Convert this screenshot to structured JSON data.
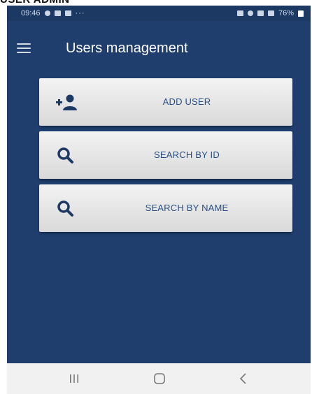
{
  "header_label": "USER ADMIN",
  "status_bar": {
    "time": "09:46",
    "dots": "···",
    "battery": "76%"
  },
  "app_bar": {
    "title": "Users management",
    "menu_icon": "hamburger-menu-icon"
  },
  "menu": [
    {
      "label": "ADD USER",
      "icon": "add-user-icon"
    },
    {
      "label": "SEARCH BY ID",
      "icon": "search-icon"
    },
    {
      "label": "SEARCH BY NAME",
      "icon": "search-icon"
    }
  ],
  "nav_bar": {
    "recents_icon": "recents-icon",
    "home_icon": "home-icon",
    "back_icon": "back-icon"
  },
  "colors": {
    "background": "#1f3e6e",
    "button": "#e6e6e6",
    "button_text": "#2a4f86",
    "icon": "#1e3a63"
  }
}
